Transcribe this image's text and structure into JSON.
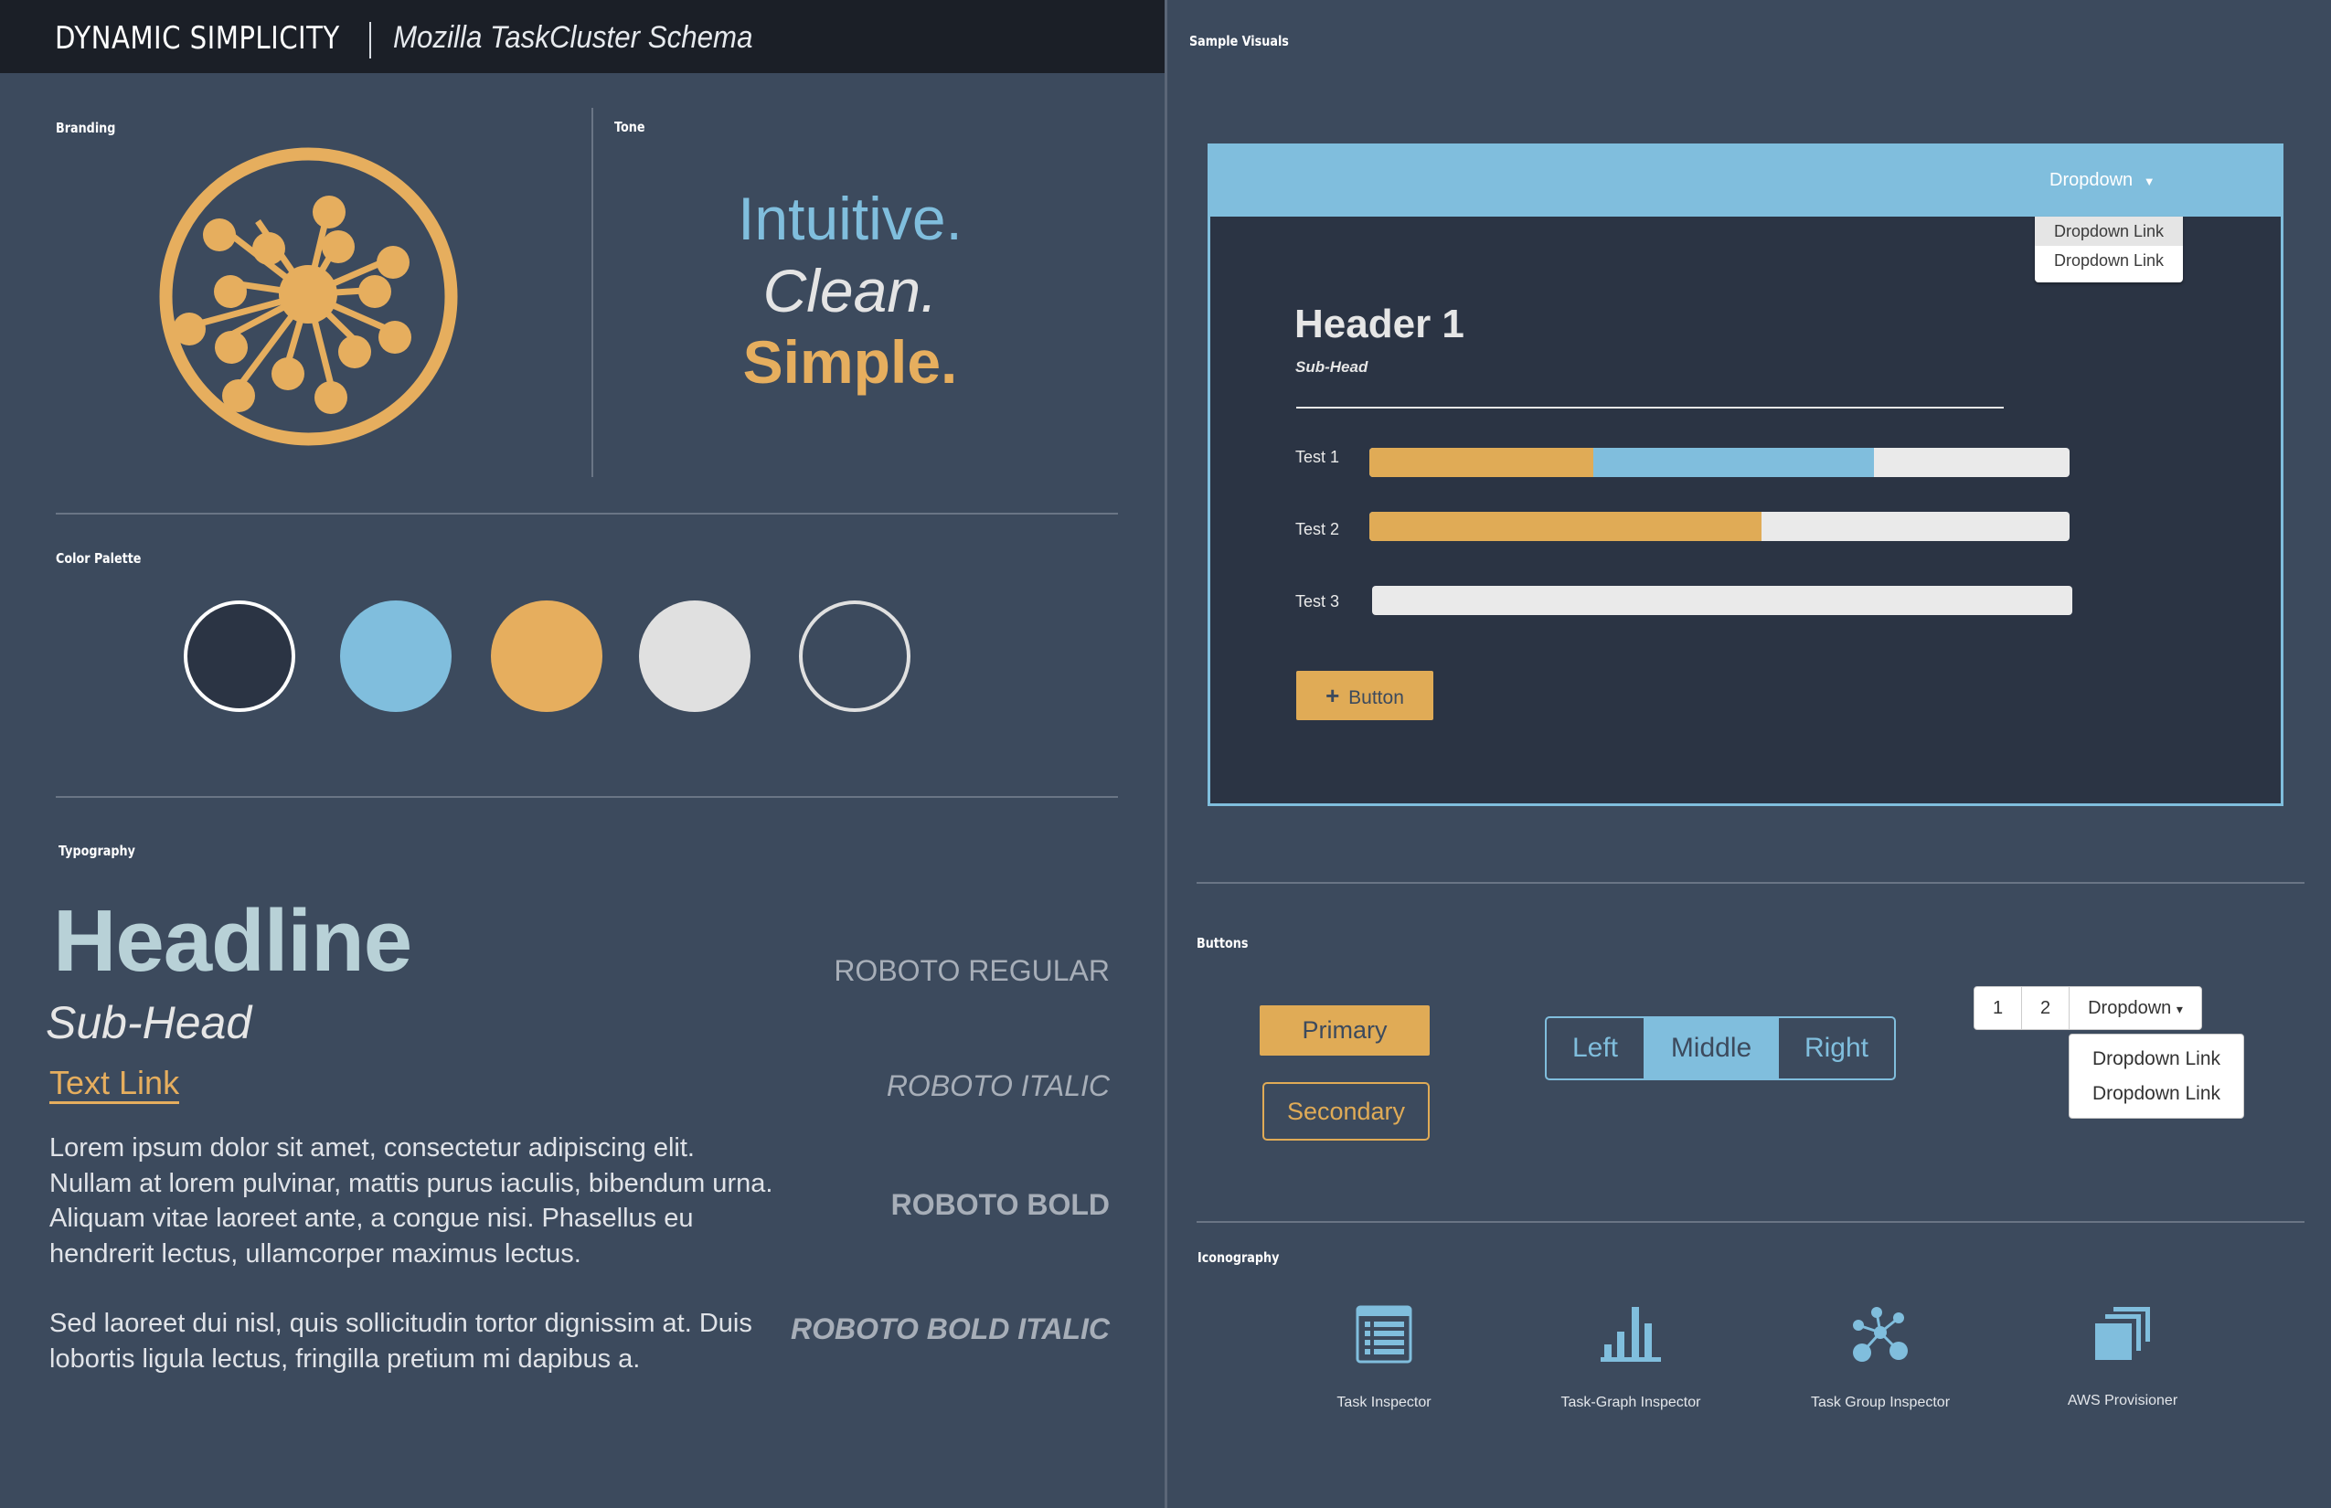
{
  "header": {
    "title": "DYNAMIC SIMPLICITY",
    "subtitle": "Mozilla TaskCluster Schema"
  },
  "sections": {
    "branding": "Branding",
    "tone": "Tone",
    "color_palette": "Color Palette",
    "typography": "Typography",
    "sample_visuals": "Sample Visuals",
    "buttons": "Buttons",
    "iconography": "Iconography"
  },
  "tone": {
    "line1": "Intuitive.",
    "line2": "Clean.",
    "line3": "Simple."
  },
  "palette": [
    {
      "name": "dark-navy",
      "color": "#2b3444",
      "border": "#ffffff"
    },
    {
      "name": "sky-blue",
      "color": "#80bedd",
      "border": "none"
    },
    {
      "name": "amber",
      "color": "#e6ae5e",
      "border": "none"
    },
    {
      "name": "light-gray",
      "color": "#e0e0e0",
      "border": "none"
    },
    {
      "name": "slate-outline",
      "color": "#3c4a5d",
      "border": "#e0e0e0"
    }
  ],
  "typography": {
    "headline": "Headline",
    "subhead": "Sub-Head",
    "text_link": "Text Link",
    "paragraph1": "Lorem ipsum dolor sit amet, consectetur adipiscing elit. Nullam at lorem pulvinar, mattis purus iaculis, bibendum urna. Aliquam vitae laoreet ante, a congue nisi. Phasellus eu hendrerit lectus, ullamcorper maximus lectus.",
    "paragraph2": "Sed laoreet dui nisl, quis sollicitudin tortor dignissim at. Duis lobortis ligula lectus, fringilla pretium mi dapibus a.",
    "font_samples": [
      "ROBOTO REGULAR",
      "ROBOTO ITALIC",
      "ROBOTO BOLD",
      "ROBOTO BOLD ITALIC"
    ]
  },
  "sample": {
    "dropdown_label": "Dropdown",
    "dropdown_caret": "▼",
    "dropdown_links": [
      "Dropdown Link",
      "Dropdown Link"
    ],
    "header1": "Header 1",
    "subhead": "Sub-Head",
    "bars": [
      {
        "label": "Test 1",
        "segments": [
          {
            "color": "#e0ab56",
            "percent": 32
          },
          {
            "color": "#80bedd",
            "percent": 40
          }
        ]
      },
      {
        "label": "Test 2",
        "segments": [
          {
            "color": "#e0ab56",
            "percent": 56
          }
        ]
      },
      {
        "label": "Test 3",
        "segments": []
      }
    ],
    "button_label": "Button",
    "button_icon": "+"
  },
  "buttons": {
    "primary": "Primary",
    "secondary": "Secondary",
    "segmented": [
      {
        "label": "Left",
        "active": false
      },
      {
        "label": "Middle",
        "active": true
      },
      {
        "label": "Right",
        "active": false
      }
    ],
    "pager": [
      "1",
      "2"
    ],
    "pager_dropdown": "Dropdown",
    "pager_caret": "▾",
    "pager_links": [
      "Dropdown Link",
      "Dropdown Link"
    ]
  },
  "icons": [
    {
      "name": "task-inspector-icon",
      "label": "Task Inspector"
    },
    {
      "name": "task-graph-inspector-icon",
      "label": "Task-Graph Inspector"
    },
    {
      "name": "task-group-inspector-icon",
      "label": "Task Group Inspector"
    },
    {
      "name": "aws-provisioner-icon",
      "label": "AWS Provisioner"
    }
  ],
  "colors": {
    "accent_blue": "#80bedd",
    "accent_amber": "#e6ae5e",
    "background": "#3c4a5d",
    "header_bg": "#1b1f27"
  }
}
